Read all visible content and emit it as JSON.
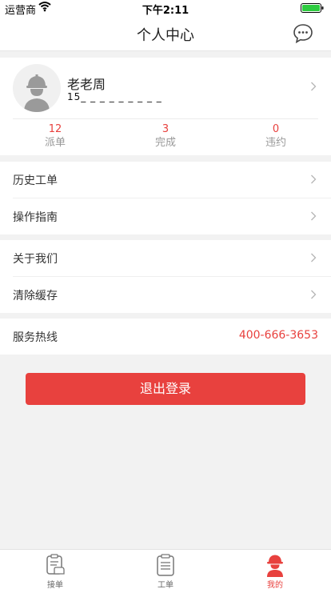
{
  "status_bar": {
    "carrier": "运营商",
    "time": "下午2:11"
  },
  "nav": {
    "title": "个人中心",
    "message_icon": "chat-bubble-icon"
  },
  "profile": {
    "name": "老老周",
    "phone": "15_ _ _ _ _ _ _ _ _",
    "stats": [
      {
        "value": "12",
        "label": "派单"
      },
      {
        "value": "3",
        "label": "完成"
      },
      {
        "value": "0",
        "label": "违约"
      }
    ]
  },
  "menu_group1": [
    {
      "label": "历史工单"
    },
    {
      "label": "操作指南"
    }
  ],
  "menu_group2": [
    {
      "label": "关于我们"
    },
    {
      "label": "清除缓存"
    }
  ],
  "hotline": {
    "label": "服务热线",
    "value": "400-666-3653"
  },
  "logout_label": "退出登录",
  "tabs": [
    {
      "label": "接单",
      "icon": "receive-order-icon",
      "active": false
    },
    {
      "label": "工单",
      "icon": "clipboard-icon",
      "active": false
    },
    {
      "label": "我的",
      "icon": "worker-helmet-icon",
      "active": true
    }
  ],
  "colors": {
    "accent": "#e8413e",
    "background": "#f2f2f2"
  }
}
